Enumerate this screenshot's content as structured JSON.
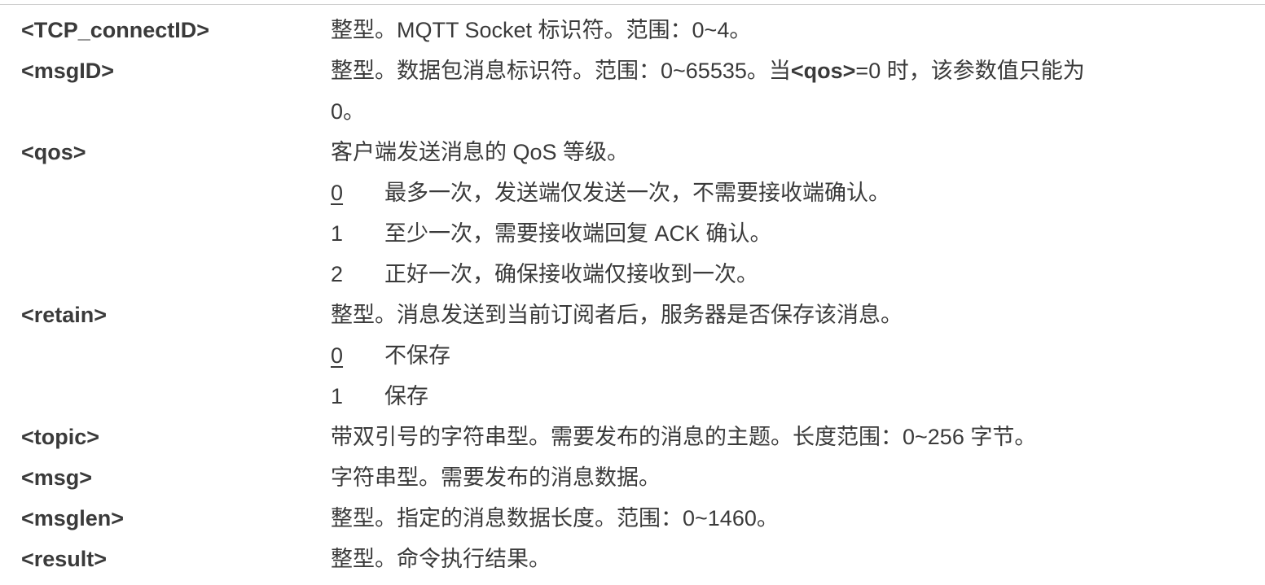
{
  "params": {
    "tcp_connectid": {
      "name": "<TCP_connectID>",
      "desc": "整型。MQTT Socket 标识符。范围：0~4。"
    },
    "msgid": {
      "name": "<msgID>",
      "desc_line1_a": "整型。数据包消息标识符。范围：0~65535。当",
      "desc_line1_bold": "<qos>",
      "desc_line1_b": "=0 时，该参数值只能为",
      "desc_line2": "0。"
    },
    "qos": {
      "name": "<qos>",
      "desc": "客户端发送消息的 QoS 等级。",
      "options": [
        {
          "value": "0",
          "text": "最多一次，发送端仅发送一次，不需要接收端确认。"
        },
        {
          "value": "1",
          "text": "至少一次，需要接收端回复 ACK 确认。"
        },
        {
          "value": "2",
          "text": "正好一次，确保接收端仅接收到一次。"
        }
      ]
    },
    "retain": {
      "name": "<retain>",
      "desc": "整型。消息发送到当前订阅者后，服务器是否保存该消息。",
      "options": [
        {
          "value": "0",
          "text": "不保存"
        },
        {
          "value": "1",
          "text": "保存"
        }
      ]
    },
    "topic": {
      "name": "<topic>",
      "desc": "带双引号的字符串型。需要发布的消息的主题。长度范围：0~256 字节。"
    },
    "msg": {
      "name": "<msg>",
      "desc": "字符串型。需要发布的消息数据。"
    },
    "msglen": {
      "name": "<msglen>",
      "desc": "整型。指定的消息数据长度。范围：0~1460。"
    },
    "result": {
      "name": "<result>",
      "desc": "整型。命令执行结果。"
    }
  }
}
